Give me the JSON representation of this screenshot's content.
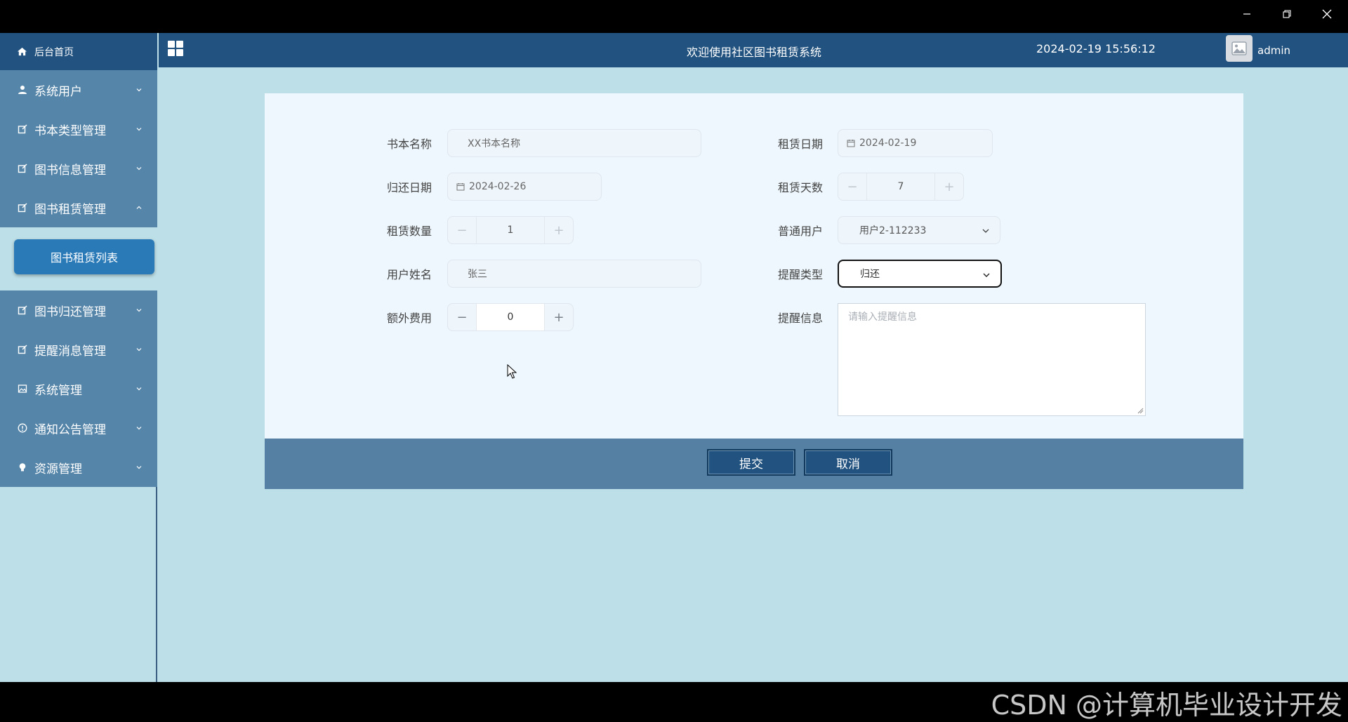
{
  "window": {
    "controls": [
      "minimize-icon",
      "restore-icon",
      "close-icon"
    ]
  },
  "sidebar": {
    "home": "后台首页",
    "items": [
      {
        "label": "系统用户",
        "icon": "user-icon",
        "expanded": false
      },
      {
        "label": "书本类型管理",
        "icon": "edit-square-icon",
        "expanded": false
      },
      {
        "label": "图书信息管理",
        "icon": "edit-square-icon",
        "expanded": false
      },
      {
        "label": "图书租赁管理",
        "icon": "edit-square-icon",
        "expanded": true
      },
      {
        "label": "图书归还管理",
        "icon": "edit-square-icon",
        "expanded": false
      },
      {
        "label": "提醒消息管理",
        "icon": "edit-square-icon",
        "expanded": false
      },
      {
        "label": "系统管理",
        "icon": "picture-icon",
        "expanded": false
      },
      {
        "label": "通知公告管理",
        "icon": "info-circle-icon",
        "expanded": false
      },
      {
        "label": "资源管理",
        "icon": "bulb-icon",
        "expanded": false
      }
    ],
    "submenu": "图书租赁列表"
  },
  "header": {
    "title": "欢迎使用社区图书租赁系统",
    "datetime": "2024-02-19 15:56:12",
    "user": "admin"
  },
  "form": {
    "book_name": {
      "label": "书本名称",
      "value": "XX书本名称"
    },
    "rent_date": {
      "label": "租赁日期",
      "value": "2024-02-19"
    },
    "return_date": {
      "label": "归还日期",
      "value": "2024-02-26"
    },
    "rent_days": {
      "label": "租赁天数",
      "value": "7"
    },
    "rent_qty": {
      "label": "租赁数量",
      "value": "1"
    },
    "normal_user": {
      "label": "普通用户",
      "value": "用户2-112233"
    },
    "user_name": {
      "label": "用户姓名",
      "value": "张三"
    },
    "remind_type": {
      "label": "提醒类型",
      "value": "归还"
    },
    "extra_fee": {
      "label": "额外费用",
      "value": "0"
    },
    "remind_info": {
      "label": "提醒信息",
      "placeholder": "请输入提醒信息"
    }
  },
  "actions": {
    "submit": "提交",
    "cancel": "取消"
  },
  "watermark": "CSDN @计算机毕业设计开发"
}
